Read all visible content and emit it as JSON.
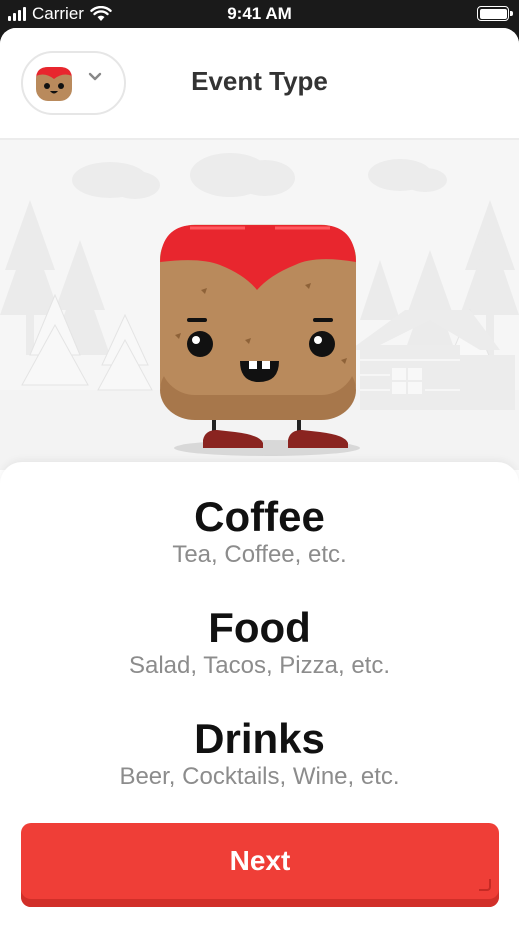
{
  "status_bar": {
    "carrier": "Carrier",
    "time": "9:41 AM"
  },
  "header": {
    "title": "Event Type",
    "avatar_icon": "toast-mascot-icon",
    "dropdown_icon": "chevron-down-icon"
  },
  "options": [
    {
      "title": "Coffee",
      "subtitle": "Tea, Coffee, etc."
    },
    {
      "title": "Food",
      "subtitle": "Salad, Tacos, Pizza, etc."
    },
    {
      "title": "Drinks",
      "subtitle": "Beer, Cocktails, Wine, etc."
    }
  ],
  "next_button": {
    "label": "Next"
  },
  "colors": {
    "accent": "#ef3e37",
    "mascot_body": "#b98a5c",
    "mascot_hair": "#e8262e",
    "shoes": "#8a2420"
  }
}
